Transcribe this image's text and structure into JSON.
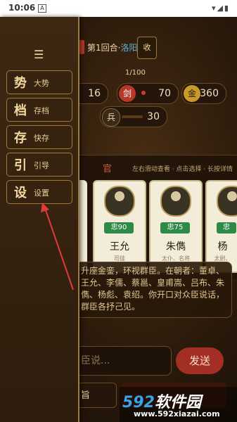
{
  "status": {
    "time": "10:06",
    "icons": "▾◢▮"
  },
  "topbar": {
    "round_prefix": "第1回合·",
    "city": "洛阳",
    "collapse_label": "收"
  },
  "progress": "1/100",
  "stats": [
    {
      "icon": "剑",
      "value": "70",
      "color": "#b8372b"
    },
    {
      "icon": "金",
      "value": "360",
      "color": "#c89a2a"
    },
    {
      "icon": "兵",
      "value": "30",
      "color": "#5a4a3a"
    },
    {
      "icon": "",
      "value": "16",
      "color": "#5a4a3a"
    }
  ],
  "panel": {
    "title_partial": "官",
    "hint": "左右滑动查看 · 点击选择 · 长按详情"
  },
  "cards": [
    {
      "name": "王允",
      "loyalty": "忠90",
      "role": "司徒"
    },
    {
      "name": "朱儁",
      "loyalty": "忠75",
      "role": "太仆、名将"
    },
    {
      "name": "杨",
      "loyalty": "忠",
      "role": "太尉、"
    }
  ],
  "story": {
    "text": "升座金銮，环视群臣。在朝者：董卓、王允、李儒、蔡邕、皇甫嵩、吕布、朱儁、杨彪、袁绍。你开口对众臣说话，群臣各抒己见。"
  },
  "input": {
    "placeholder": "臣说..."
  },
  "send_label": "发送",
  "bottom_left_label": "旨",
  "menu": {
    "items": [
      {
        "big": "势",
        "small": "大势"
      },
      {
        "big": "档",
        "small": "存档"
      },
      {
        "big": "存",
        "small": "快存"
      },
      {
        "big": "引",
        "small": "引导"
      },
      {
        "big": "设",
        "small": "设置"
      }
    ]
  },
  "watermark": {
    "brand_num": "592",
    "brand_text": "软件园",
    "url": "www.592xiazai.com"
  }
}
